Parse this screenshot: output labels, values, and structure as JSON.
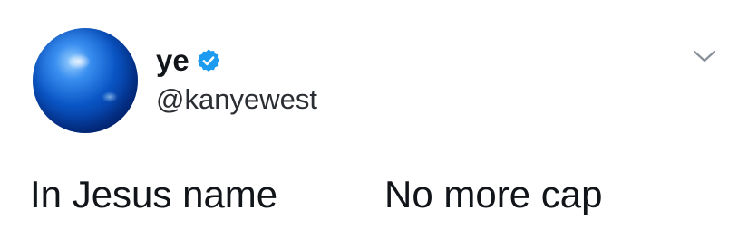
{
  "tweet": {
    "author": {
      "display_name": "ye",
      "handle": "@kanyewest",
      "verified": true,
      "avatar_icon": "blue-sphere-avatar"
    },
    "text_parts": [
      "In Jesus name",
      "No more cap"
    ],
    "menu_icon": "chevron-down-icon"
  },
  "colors": {
    "verified_badge": "#1d9bf0",
    "caret": "#8a9099",
    "text": "#111418"
  }
}
